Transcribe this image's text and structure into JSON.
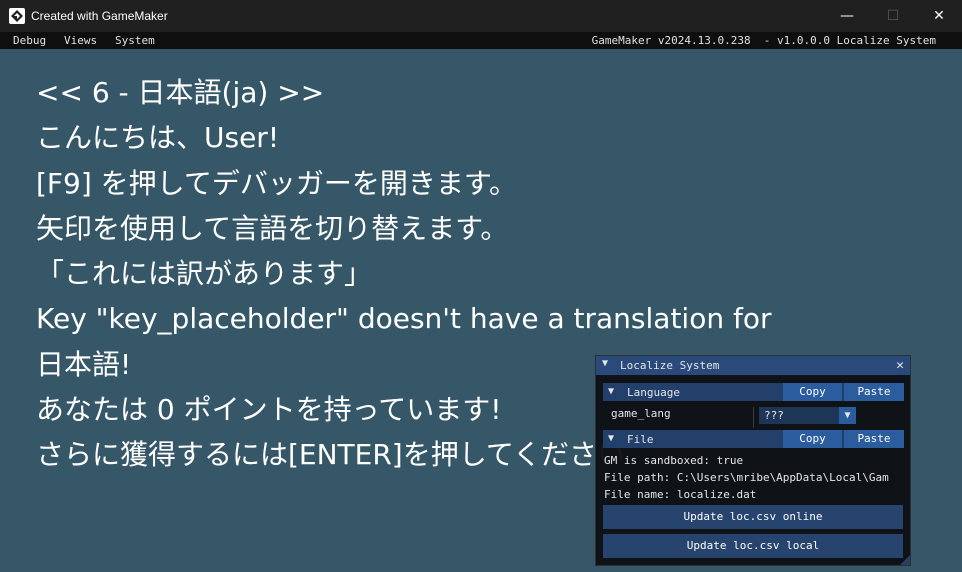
{
  "window": {
    "title": "Created with GameMaker",
    "controls": {
      "minimize": "—",
      "maximize": "☐",
      "close": "✕"
    }
  },
  "menubar": {
    "items": [
      "Debug",
      "Views",
      "System"
    ],
    "right_text": "GameMaker v2024.13.0.238  - v1.0.0.0 Localize System"
  },
  "main": {
    "lines": [
      "<< 6 - 日本語(ja) >>",
      "こんにちは、User!",
      "[F9] を押してデバッガーを開きます。",
      "矢印を使用して言語を切り替えます。",
      "「これには訳があります」",
      "Key \"key_placeholder\" doesn't have a translation for",
      "日本語!",
      "あなたは 0 ポイントを持っています!",
      "さらに獲得するには[ENTER]を押してください"
    ]
  },
  "panel": {
    "title": "Localize System",
    "close_glyph": "✕",
    "collapse_glyph": "▼",
    "language_section": {
      "label": "Language",
      "copy_label": "Copy",
      "paste_label": "Paste",
      "field_label": "game_lang",
      "combo_value": "???",
      "combo_glyph": "▼"
    },
    "file_section": {
      "label": "File",
      "copy_label": "Copy",
      "paste_label": "Paste",
      "lines": [
        "GM is sandboxed: true",
        "File path: C:\\Users\\mribe\\AppData\\Local\\Gam",
        "File name: localize.dat"
      ]
    },
    "buttons": {
      "online": "Update loc.csv online",
      "local": "Update loc.csv local"
    }
  },
  "colors": {
    "background": "#365767",
    "titlebar": "#202020",
    "menubar": "#0f0f0f",
    "panel_title": "#294a7a",
    "button": "#2b5c9e"
  }
}
